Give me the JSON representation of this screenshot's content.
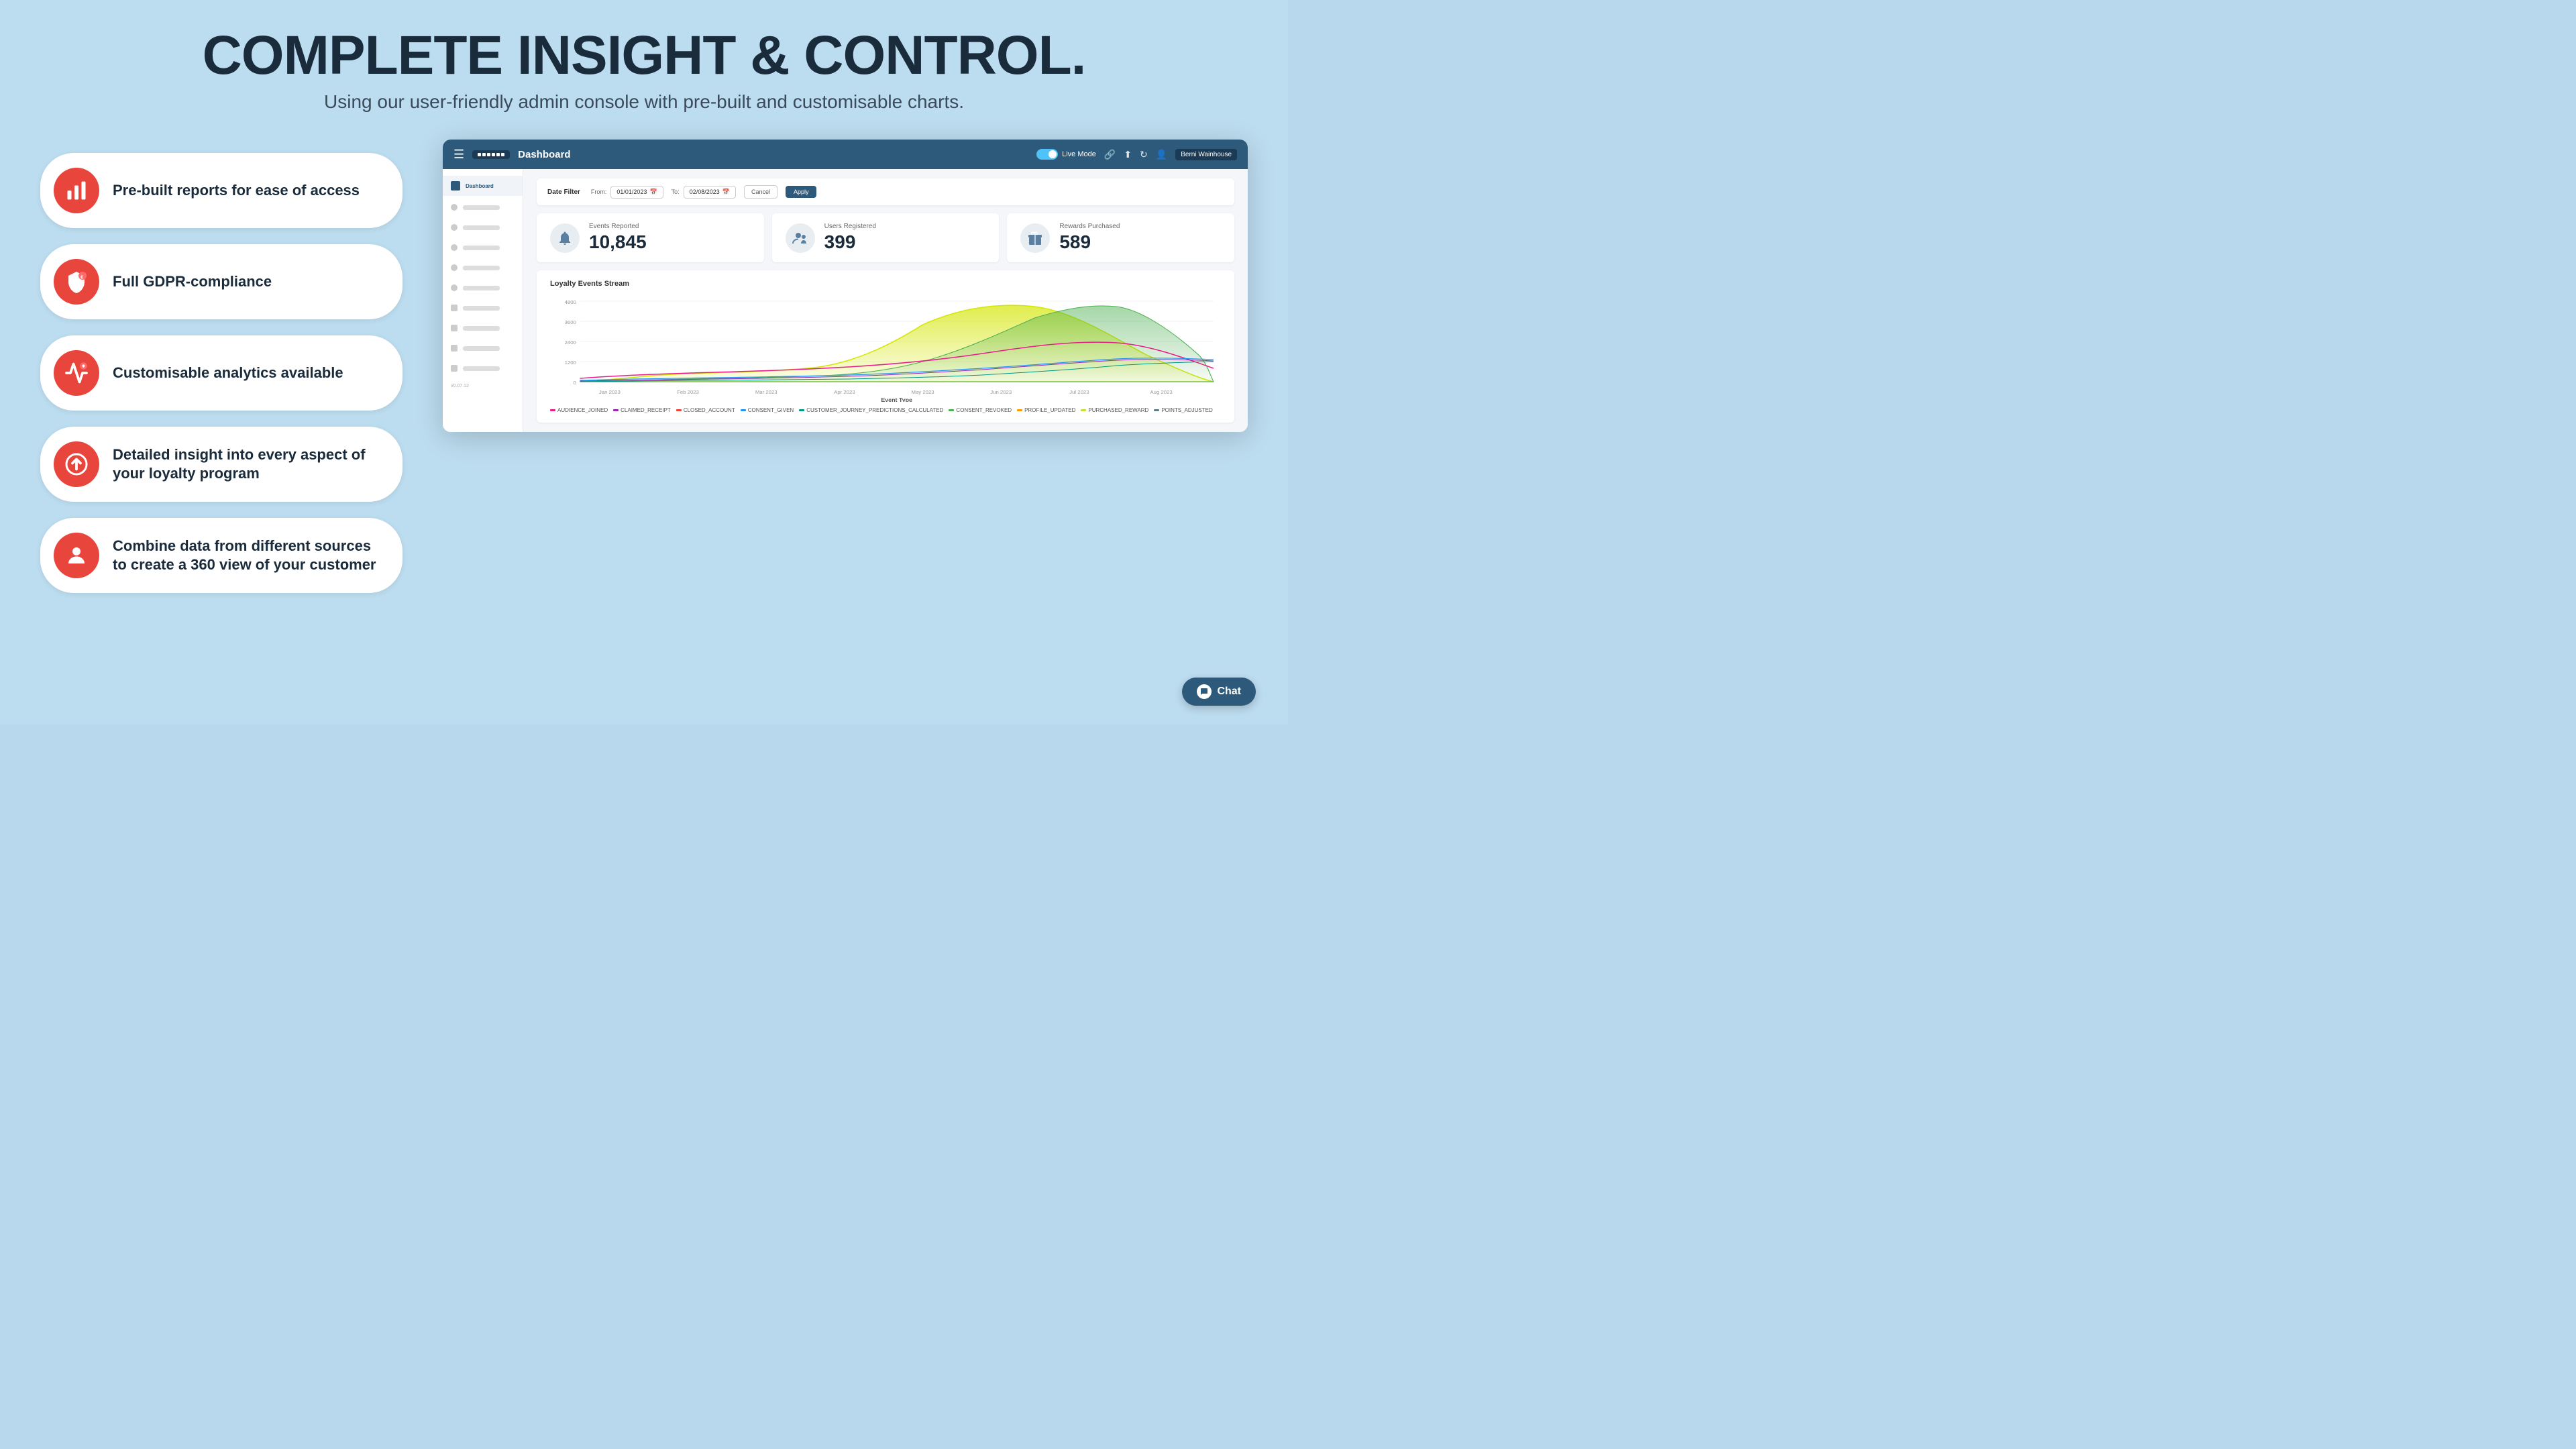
{
  "page": {
    "background_color": "#bcdcef"
  },
  "header": {
    "main_title": "COMPLETE INSIGHT & CONTROL.",
    "subtitle": "Using our user-friendly admin console with pre-built and customisable charts."
  },
  "features": [
    {
      "id": "prebuilt-reports",
      "icon": "bar-chart-icon",
      "text": "Pre-built reports for ease of access"
    },
    {
      "id": "gdpr",
      "icon": "gdpr-icon",
      "text": "Full GDPR-compliance"
    },
    {
      "id": "analytics",
      "icon": "analytics-icon",
      "text": "Customisable analytics available"
    },
    {
      "id": "insight",
      "icon": "arrow-up-icon",
      "text": "Detailed insight into every aspect of your loyalty program"
    },
    {
      "id": "combine-data",
      "icon": "person-icon",
      "text": "Combine data from different sources to create a 360 view of your customer"
    }
  ],
  "dashboard": {
    "header": {
      "title": "Dashboard",
      "live_mode_label": "Live Mode",
      "user_name": "Berni Wainhouse"
    },
    "date_filter": {
      "label": "Date Filter",
      "from_label": "From:",
      "to_label": "To:",
      "from_date": "01/01/2023",
      "to_date": "02/08/2023",
      "cancel_label": "Cancel",
      "apply_label": "Apply"
    },
    "stats": [
      {
        "id": "events-reported",
        "label": "Events Reported",
        "value": "10,845",
        "icon": "bell-icon"
      },
      {
        "id": "users-registered",
        "label": "Users Registered",
        "value": "399",
        "icon": "users-icon"
      },
      {
        "id": "rewards-purchased",
        "label": "Rewards Purchased",
        "value": "589",
        "icon": "gift-icon"
      }
    ],
    "chart": {
      "title": "Loyalty Events Stream",
      "y_axis": [
        "4800",
        "3600",
        "2400",
        "1200",
        "0"
      ],
      "x_axis": [
        "Jan 2023",
        "Feb 2023",
        "Mar 2023",
        "Apr 2023",
        "May 2023",
        "Jun 2023",
        "Jul 2023",
        "Aug 2023"
      ],
      "event_type_label": "Event Type",
      "legend": [
        {
          "color": "#e91e8c",
          "label": "AUDIENCE_JOINED"
        },
        {
          "color": "#9c27b0",
          "label": "CLAIMED_RECEIPT"
        },
        {
          "color": "#f44336",
          "label": "CLOSED_ACCOUNT"
        },
        {
          "color": "#2196f3",
          "label": "CONSENT_GIVEN"
        },
        {
          "color": "#009688",
          "label": "CUSTOMER_JOURNEY_PREDICTIONS_CALCULATED"
        },
        {
          "color": "#4caf50",
          "label": "CONSENT_REVOKED"
        },
        {
          "color": "#ff9800",
          "label": "PROFILE_UPDATED"
        },
        {
          "color": "#cddc39",
          "label": "PURCHASED_REWARD"
        },
        {
          "color": "#607d8b",
          "label": "POINTS_ADJUSTED"
        }
      ]
    }
  },
  "chat_button": {
    "label": "Chat"
  }
}
